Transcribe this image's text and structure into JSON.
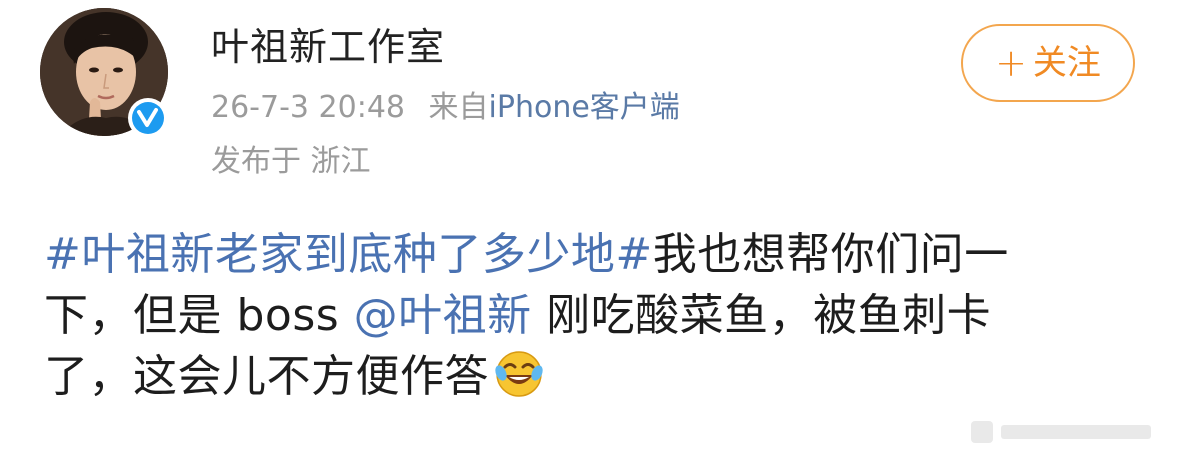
{
  "header": {
    "username": "叶祖新工作室",
    "timestamp": "26-7-3 20:48",
    "source_prefix": "来自",
    "source": "iPhone客户端",
    "location": "发布于 浙江",
    "follow_label": "关注",
    "follow_plus": "+"
  },
  "post": {
    "topic": "#叶祖新老家到底种了多少地#",
    "line1_rest": "我也想帮你们问一",
    "line2_pre": "下，但是 boss ",
    "mention": "@叶祖新",
    "line2_post": " 刚吃酸菜鱼，被鱼刺卡",
    "line3": "了，这会儿不方便作答"
  },
  "icons": {
    "verified": "verified-badge-icon",
    "emoji": "laughing-crying-emoji-icon"
  },
  "colors": {
    "link_blue": "#4a72b2",
    "follow_orange": "#f08a24",
    "verified_blue": "#1d9bf0",
    "meta_gray": "#9b9b9b"
  }
}
